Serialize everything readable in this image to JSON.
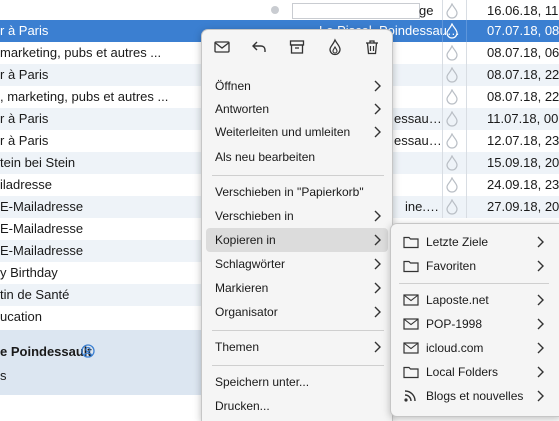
{
  "message_list": {
    "rows": [
      {
        "subject": "",
        "partial": "ge",
        "date": "16.06.18, 11:"
      },
      {
        "subject": "r à Paris",
        "partial": "Le Piscol, Poindessau…",
        "date": "07.07.18, 08:"
      },
      {
        "subject": " marketing, pubs et autres ...",
        "partial": "",
        "date": "08.07.18, 06:"
      },
      {
        "subject": "r à Paris",
        "partial": "",
        "date": "08.07.18, 22:"
      },
      {
        "subject": " , marketing, pubs et autres ...",
        "partial": "",
        "date": "08.07.18, 22:"
      },
      {
        "subject": "r à Paris",
        "partial": "essau…",
        "date": "11.07.18, 00:"
      },
      {
        "subject": "r à Paris",
        "partial": "essau…",
        "date": "12.07.18, 23:"
      },
      {
        "subject": "tein bei Stein",
        "partial": "",
        "date": "15.09.18, 20:"
      },
      {
        "subject": "iladresse",
        "partial": "",
        "date": "24.09.18, 23:"
      },
      {
        "subject": "E-Mailadresse",
        "partial": "ine.…",
        "date": "27.09.18, 20:"
      },
      {
        "subject": "E-Mailadresse",
        "partial": "",
        "date": ""
      },
      {
        "subject": "E-Mailadresse",
        "partial": "",
        "date": ""
      },
      {
        "subject": "y Birthday",
        "partial": "",
        "date": ""
      },
      {
        "subject": "tin de Santé",
        "partial": "",
        "date": ""
      },
      {
        "subject": "ucation",
        "partial": "",
        "date": ""
      }
    ]
  },
  "preview": {
    "from": "e Poindessault",
    "second_line": "s"
  },
  "context_menu": {
    "toolbar_icons": [
      "mail-icon",
      "reply-icon",
      "archive-icon",
      "junk-flame-icon",
      "trash-icon"
    ],
    "items": [
      {
        "label": "Öffnen",
        "submenu": true
      },
      {
        "label": "Antworten",
        "submenu": true
      },
      {
        "label": "Weiterleiten und umleiten",
        "submenu": true
      },
      {
        "label": "Als neu bearbeiten",
        "submenu": false
      },
      {
        "label": "Verschieben in \"Papierkorb\"",
        "submenu": false
      },
      {
        "label": "Verschieben in",
        "submenu": true
      },
      {
        "label": "Kopieren in",
        "submenu": true
      },
      {
        "label": "Schlagwörter",
        "submenu": true
      },
      {
        "label": "Markieren",
        "submenu": true
      },
      {
        "label": "Organisator",
        "submenu": true
      },
      {
        "label": "Themen",
        "submenu": true
      },
      {
        "label": "Speichern unter...",
        "submenu": false
      },
      {
        "label": "Drucken...",
        "submenu": false
      }
    ]
  },
  "submenu": {
    "items": [
      {
        "label": "Letzte Ziele",
        "icon": "folder-icon"
      },
      {
        "label": "Favoriten",
        "icon": "folder-icon"
      },
      {
        "label": "Laposte.net",
        "icon": "mail-account-icon"
      },
      {
        "label": "POP-1998",
        "icon": "mail-account-icon"
      },
      {
        "label": "icloud.com",
        "icon": "mail-account-icon"
      },
      {
        "label": "Local Folders",
        "icon": "folder-icon"
      },
      {
        "label": "Blogs et nouvelles",
        "icon": "rss-icon"
      }
    ]
  },
  "colors": {
    "selection": "#3b7fd1",
    "alt_row": "#eef3f8",
    "menu_bg": "#f5f5f5",
    "menu_hover": "#dcdcdc"
  }
}
